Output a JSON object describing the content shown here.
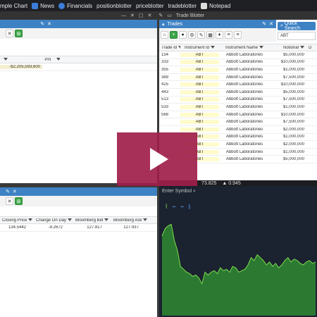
{
  "topbar": {
    "items": [
      {
        "label": "mple Chart",
        "icon": "chart-icon",
        "color": "#e6e6e6"
      },
      {
        "label": "News",
        "icon": "news-icon",
        "color": "#3b7dd8"
      },
      {
        "label": "Financials",
        "icon": "financials-icon",
        "color": "#3b7dd8"
      },
      {
        "label": "positionblotter",
        "icon": "",
        "color": ""
      },
      {
        "label": "priceblotter",
        "icon": "",
        "color": ""
      },
      {
        "label": "tradeblotter",
        "icon": "",
        "color": ""
      },
      {
        "label": "Notepad",
        "icon": "notepad-icon",
        "color": "#e6e6e6"
      }
    ]
  },
  "window_controls": {
    "tab_title": "Trade Blotter"
  },
  "left_top": {
    "headers": [
      "Pnl"
    ],
    "pnl_value": "-$2,205,593,600"
  },
  "left_bottom": {
    "headers": [
      "Closing Price",
      "Change On Day",
      "Bloomberg Bid",
      "Bloomberg Ask"
    ],
    "row": [
      "134.5442",
      "-9.2672",
      "127.817",
      "127.937"
    ]
  },
  "trades": {
    "title": "Trades",
    "quick_search_label": "Quick Search",
    "search_value": "ABT",
    "headers": [
      "Trade Id",
      "Instrument Id",
      "Instrument Name",
      "Notional",
      "D"
    ],
    "rows": [
      [
        "154",
        "ABT",
        "Abbott Laboratories",
        "$5,000,000"
      ],
      [
        "333",
        "ABT",
        "Abbott Laboratories",
        "$10,000,000"
      ],
      [
        "355",
        "ABT",
        "Abbott Laboratories",
        "$1,000,000"
      ],
      [
        "389",
        "ABT",
        "Abbott Laboratories",
        "$7,500,000"
      ],
      [
        "425",
        "ABT",
        "Abbott Laboratories",
        "$10,000,000"
      ],
      [
        "443",
        "ABT",
        "Abbott Laboratories",
        "$5,000,000"
      ],
      [
        "513",
        "ABT",
        "Abbott Laboratories",
        "$7,500,000"
      ],
      [
        "533",
        "ABT",
        "Abbott Laboratories",
        "$1,000,000"
      ],
      [
        "568",
        "ABT",
        "Abbott Laboratories",
        "$10,000,000"
      ],
      [
        "",
        "ABT",
        "Abbott Laboratories",
        "$7,500,000"
      ],
      [
        "",
        "ABT",
        "Abbott Laboratories",
        "$2,000,000"
      ],
      [
        "",
        "ABT",
        "Abbott Laboratories",
        "$1,000,000"
      ],
      [
        "",
        "ABT",
        "Abbott Laboratories",
        "$2,000,000"
      ],
      [
        "",
        "ABT",
        "Abbott Laboratories",
        "$1,000,000"
      ],
      [
        "",
        "ABT",
        "Abbott Laboratories",
        "$5,000,000"
      ]
    ]
  },
  "status": {
    "value1": "73.825",
    "value2": "▲ 0.945"
  },
  "chart": {
    "symbol_label": "Enter Symbol",
    "series_values": [
      55,
      60,
      62,
      63,
      52,
      45,
      34,
      32,
      30,
      29,
      27,
      28,
      26,
      22,
      30,
      28,
      30,
      31,
      29,
      33,
      31,
      32,
      30,
      34,
      33,
      30,
      31,
      32,
      35,
      40,
      38,
      42,
      40,
      38,
      35,
      37,
      34,
      36,
      33,
      35,
      38,
      40,
      37,
      39,
      38,
      36,
      35,
      37,
      38,
      36,
      37
    ],
    "line_color": "#7ddc4b",
    "fill_color": "#2f8a32"
  },
  "play_button": {
    "color": "#a01e4b"
  }
}
